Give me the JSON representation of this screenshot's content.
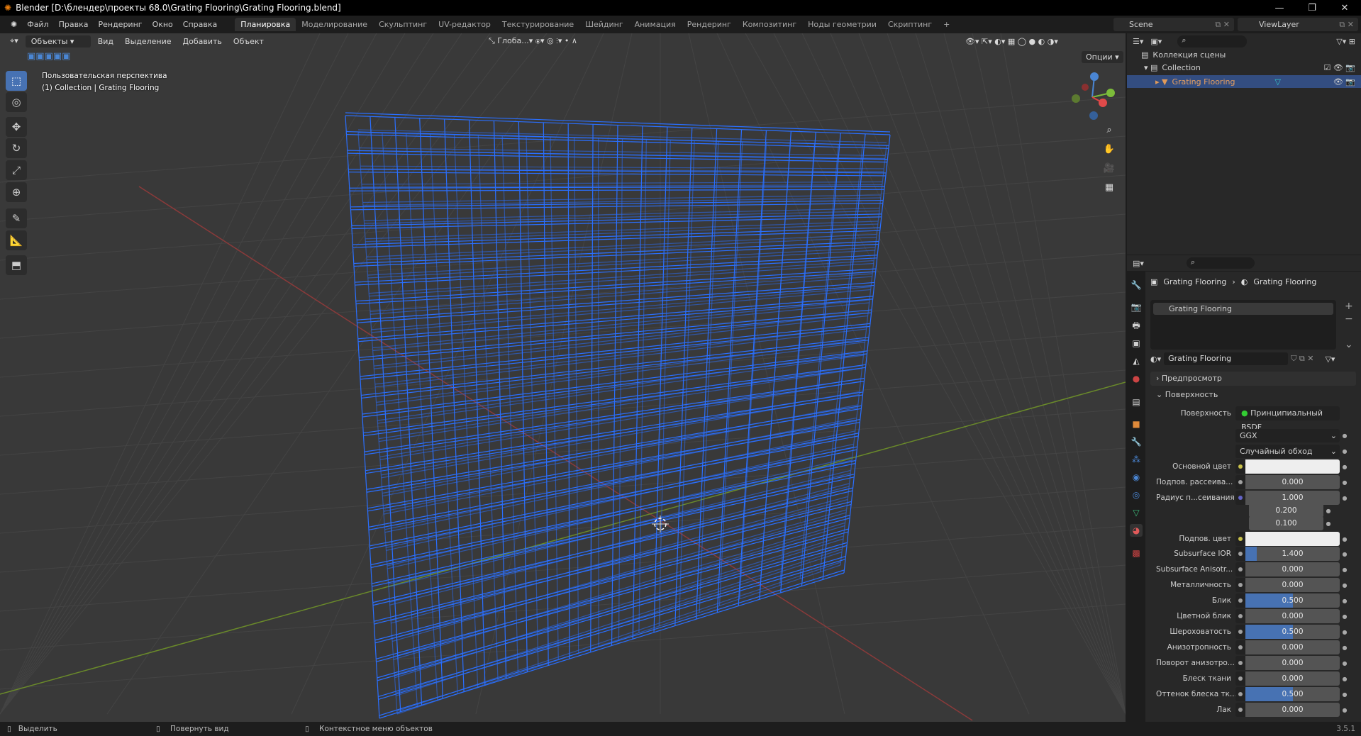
{
  "title": "Blender [D:\\блендер\\проекты 68.0\\Grating Flooring\\Grating Flooring.blend]",
  "menu": [
    "Файл",
    "Правка",
    "Рендеринг",
    "Окно",
    "Справка"
  ],
  "workspaces": [
    "Планировка",
    "Моделирование",
    "Скульптинг",
    "UV-редактор",
    "Текстурирование",
    "Шейдинг",
    "Анимация",
    "Рендеринг",
    "Композитинг",
    "Ноды геометрии",
    "Скриптинг",
    "+"
  ],
  "scene": "Scene",
  "view_layer": "ViewLayer",
  "viewport": {
    "mode": "Объекты",
    "menus": [
      "Вид",
      "Выделение",
      "Добавить",
      "Объект"
    ],
    "transform": "Глоба...",
    "options": "Опции",
    "view_name": "Пользовательская перспектива",
    "collection_info": "(1) Collection | Grating Flooring"
  },
  "outliner": {
    "root": "Коллекция сцены",
    "collection": "Collection",
    "object": "Grating Flooring"
  },
  "properties": {
    "breadcrumb": [
      "Grating Flooring",
      "Grating Flooring"
    ],
    "slot": "Grating Flooring",
    "material": "Grating Flooring",
    "preview_label": "Предпросмотр",
    "surface_panel": "Поверхность",
    "surface_label": "Поверхность",
    "surface_value": "Принципиальный BSDF",
    "distribution": "GGX",
    "subsurface_method": "Случайный обход",
    "rows": [
      {
        "label": "Основной цвет",
        "type": "color",
        "socket": "#c8c04a"
      },
      {
        "label": "Подпов. рассеива...",
        "value": "0.000",
        "fill": 0
      },
      {
        "label": "Радиус п...сеивания",
        "value": "1.000",
        "fill": 0,
        "socket": "#6363c7"
      },
      {
        "label": "",
        "value": "0.200",
        "fill": 0
      },
      {
        "label": "",
        "value": "0.100",
        "fill": 0
      },
      {
        "label": "Подпов. цвет",
        "type": "color",
        "socket": "#c8c04a"
      },
      {
        "label": "Subsurface IOR",
        "value": "1.400",
        "fill": 0.12
      },
      {
        "label": "Subsurface Anisotr...",
        "value": "0.000",
        "fill": 0
      },
      {
        "label": "Металличность",
        "value": "0.000",
        "fill": 0
      },
      {
        "label": "Блик",
        "value": "0.500",
        "fill": 0.5
      },
      {
        "label": "Цветной блик",
        "value": "0.000",
        "fill": 0
      },
      {
        "label": "Шероховатость",
        "value": "0.500",
        "fill": 0.5
      },
      {
        "label": "Анизотропность",
        "value": "0.000",
        "fill": 0
      },
      {
        "label": "Поворот анизотро...",
        "value": "0.000",
        "fill": 0
      },
      {
        "label": "Блеск ткани",
        "value": "0.000",
        "fill": 0
      },
      {
        "label": "Оттенок блеска тк...",
        "value": "0.500",
        "fill": 0.5
      },
      {
        "label": "Лак",
        "value": "0.000",
        "fill": 0
      }
    ]
  },
  "status": {
    "select": "Выделить",
    "rotate": "Повернуть вид",
    "context": "Контекстное меню объектов",
    "version": "3.5.1"
  },
  "colors": {
    "accent": "#4772b3",
    "wire": "#2a6fff",
    "bg": "#393939"
  }
}
